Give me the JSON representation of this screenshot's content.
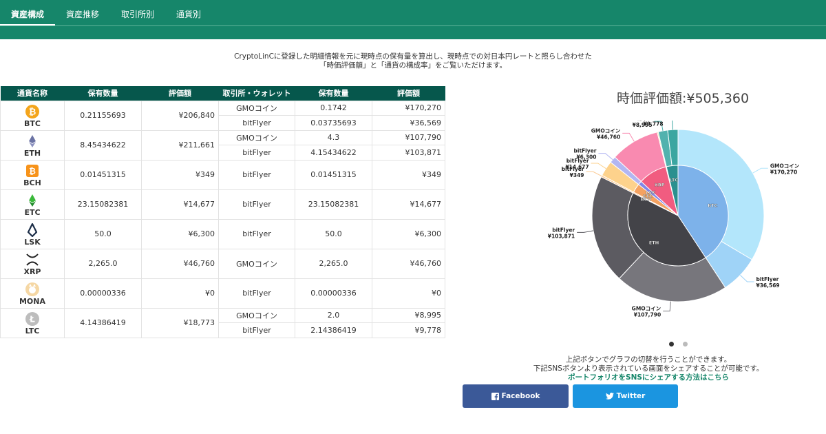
{
  "nav": {
    "tabs": [
      "資産構成",
      "資産推移",
      "取引所別",
      "通貨別"
    ],
    "active": 0,
    "color": "#16866a"
  },
  "intro": {
    "line1": "CryptoLinCに登録した明細情報を元に現時点の保有量を算出し、現時点での対日本円レートと照らし合わせた",
    "line2": "「時価評価額」と「通貨の構成率」をご覧いただけます。"
  },
  "table": {
    "headers": [
      "通貨名称",
      "保有数量",
      "評価額",
      "取引所・ウォレット",
      "保有数量",
      "評価額"
    ],
    "coins": [
      {
        "symbol": "BTC",
        "icon": "bitcoin-icon",
        "color": "#f4a51c",
        "amount": "0.21155693",
        "value": "¥206,840",
        "exchanges": [
          {
            "name": "GMOコイン",
            "amount": "0.1742",
            "value": "¥170,270"
          },
          {
            "name": "bitFlyer",
            "amount": "0.03735693",
            "value": "¥36,569"
          }
        ]
      },
      {
        "symbol": "ETH",
        "icon": "ethereum-icon",
        "color": "#6b73a4",
        "amount": "8.45434622",
        "value": "¥211,661",
        "exchanges": [
          {
            "name": "GMOコイン",
            "amount": "4.3",
            "value": "¥107,790"
          },
          {
            "name": "bitFlyer",
            "amount": "4.15434622",
            "value": "¥103,871"
          }
        ]
      },
      {
        "symbol": "BCH",
        "icon": "bitcoin-cash-icon",
        "color": "#f7931a",
        "amount": "0.01451315",
        "value": "¥349",
        "exchanges": [
          {
            "name": "bitFlyer",
            "amount": "0.01451315",
            "value": "¥349"
          }
        ]
      },
      {
        "symbol": "ETC",
        "icon": "ethereum-classic-icon",
        "color": "#3ab83a",
        "amount": "23.15082381",
        "value": "¥14,677",
        "exchanges": [
          {
            "name": "bitFlyer",
            "amount": "23.15082381",
            "value": "¥14,677"
          }
        ]
      },
      {
        "symbol": "LSK",
        "icon": "lisk-icon",
        "color": "#1a2c46",
        "amount": "50.0",
        "value": "¥6,300",
        "exchanges": [
          {
            "name": "bitFlyer",
            "amount": "50.0",
            "value": "¥6,300"
          }
        ]
      },
      {
        "symbol": "XRP",
        "icon": "ripple-icon",
        "color": "#222222",
        "amount": "2,265.0",
        "value": "¥46,760",
        "exchanges": [
          {
            "name": "GMOコイン",
            "amount": "2,265.0",
            "value": "¥46,760"
          }
        ]
      },
      {
        "symbol": "MONA",
        "icon": "monacoin-icon",
        "color": "#f5d7a4",
        "amount": "0.00000336",
        "value": "¥0",
        "exchanges": [
          {
            "name": "bitFlyer",
            "amount": "0.00000336",
            "value": "¥0"
          }
        ]
      },
      {
        "symbol": "LTC",
        "icon": "litecoin-icon",
        "color": "#bdbdbd",
        "amount": "4.14386419",
        "value": "¥18,773",
        "exchanges": [
          {
            "name": "GMOコイン",
            "amount": "2.0",
            "value": "¥8,995"
          },
          {
            "name": "bitFlyer",
            "amount": "2.14386419",
            "value": "¥9,778"
          }
        ]
      }
    ]
  },
  "total_label": "時価評価額:¥505,360",
  "chart_data": {
    "type": "pie",
    "title": "時価評価額:¥505,360",
    "inner": [
      {
        "name": "BTC",
        "value": 206840,
        "color": "#7db2ea"
      },
      {
        "name": "ETH",
        "value": 211661,
        "color": "#434348"
      },
      {
        "name": "BCH",
        "value": 349,
        "color": "#f7a35c"
      },
      {
        "name": "ETC",
        "value": 14677,
        "color": "#f4a261"
      },
      {
        "name": "LSK",
        "value": 6300,
        "color": "#8085e9"
      },
      {
        "name": "XRP",
        "value": 46760,
        "color": "#f15c80"
      },
      {
        "name": "MONA",
        "value": 0,
        "color": "#e4d354"
      },
      {
        "name": "LTC",
        "value": 18773,
        "color": "#2b908f"
      }
    ],
    "outer": [
      {
        "name": "GMOコイン",
        "label": "¥170,270",
        "value": 170270,
        "color": "#b3e6fb"
      },
      {
        "name": "bitFlyer",
        "label": "¥36,569",
        "value": 36569,
        "color": "#9fd3f7"
      },
      {
        "name": "GMOコイン",
        "label": "¥107,790",
        "value": 107790,
        "color": "#77767c"
      },
      {
        "name": "bitFlyer",
        "label": "¥103,871",
        "value": 103871,
        "color": "#5c5b61"
      },
      {
        "name": "bitFlyer",
        "label": "¥349",
        "value": 349,
        "color": "#fbc991"
      },
      {
        "name": "bitFlyer",
        "label": "¥14,677",
        "value": 14677,
        "color": "#fdd28c"
      },
      {
        "name": "bitFlyer",
        "label": "¥6,300",
        "value": 6300,
        "color": "#b3b6f2"
      },
      {
        "name": "GMOコイン",
        "label": "¥46,760",
        "value": 46760,
        "color": "#f98ab0"
      },
      {
        "name": "bitFlyer",
        "label": "¥0",
        "value": 0,
        "color": "#f2e48a"
      },
      {
        "name": "GMOコイン",
        "label": "¥8,995",
        "value": 8995,
        "color": "#52b2ae"
      },
      {
        "name": "bitFlyer",
        "label": "¥9,778",
        "value": 9778,
        "color": "#3aa6a1"
      }
    ],
    "hidden_outer_labels": [
      8
    ]
  },
  "carousel": {
    "count": 2,
    "active": 0,
    "active_color": "#333333",
    "inactive_color": "#bbbbbb"
  },
  "notes": {
    "line1": "上記ボタンでグラフの切替を行うことができます。",
    "line2": "下記SNSボタンより表示されている画面をシェアすることが可能です。",
    "link": "ポートフォリオをSNSにシェアする方法はこちら"
  },
  "share": {
    "facebook": "Facebook",
    "twitter": "Twitter",
    "facebook_color": "#3b5998",
    "twitter_color": "#1b95e0"
  }
}
